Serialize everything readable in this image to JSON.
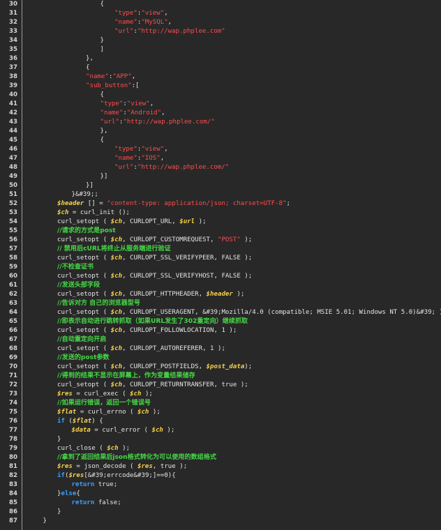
{
  "editor": {
    "lines": [
      {
        "num": "30",
        "indent": 5,
        "tokens": [
          [
            "p",
            "{"
          ]
        ]
      },
      {
        "num": "31",
        "indent": 6,
        "tokens": [
          [
            "s",
            "\"type\""
          ],
          [
            "p",
            ":"
          ],
          [
            "s",
            "\"view\""
          ],
          [
            "p",
            ","
          ]
        ]
      },
      {
        "num": "32",
        "indent": 6,
        "tokens": [
          [
            "s",
            "\"name\""
          ],
          [
            "p",
            ":"
          ],
          [
            "s",
            "\"MySQL\""
          ],
          [
            "p",
            ","
          ]
        ]
      },
      {
        "num": "33",
        "indent": 6,
        "tokens": [
          [
            "s",
            "\"url\""
          ],
          [
            "p",
            ":"
          ],
          [
            "s",
            "\"http://wap.phplee.com\""
          ]
        ]
      },
      {
        "num": "34",
        "indent": 5,
        "tokens": [
          [
            "p",
            "}"
          ]
        ]
      },
      {
        "num": "35",
        "indent": 5,
        "tokens": [
          [
            "p",
            "]"
          ]
        ]
      },
      {
        "num": "36",
        "indent": 4,
        "tokens": [
          [
            "p",
            "},"
          ]
        ]
      },
      {
        "num": "37",
        "indent": 4,
        "tokens": [
          [
            "p",
            "{"
          ]
        ]
      },
      {
        "num": "38",
        "indent": 4,
        "tokens": [
          [
            "s",
            "\"name\""
          ],
          [
            "p",
            ":"
          ],
          [
            "s",
            "\"APP\""
          ],
          [
            "p",
            ","
          ]
        ]
      },
      {
        "num": "39",
        "indent": 4,
        "tokens": [
          [
            "s",
            "\"sub_button\""
          ],
          [
            "p",
            ":["
          ]
        ]
      },
      {
        "num": "40",
        "indent": 5,
        "tokens": [
          [
            "p",
            "{"
          ]
        ]
      },
      {
        "num": "41",
        "indent": 5,
        "tokens": [
          [
            "s",
            "\"type\""
          ],
          [
            "p",
            ":"
          ],
          [
            "s",
            "\"view\""
          ],
          [
            "p",
            ","
          ]
        ]
      },
      {
        "num": "42",
        "indent": 5,
        "tokens": [
          [
            "s",
            "\"name\""
          ],
          [
            "p",
            ":"
          ],
          [
            "s",
            "\"Android\""
          ],
          [
            "p",
            ","
          ]
        ]
      },
      {
        "num": "43",
        "indent": 5,
        "tokens": [
          [
            "s",
            "\"url\""
          ],
          [
            "p",
            ":"
          ],
          [
            "s",
            "\"http://wap.phplee.com/\""
          ]
        ]
      },
      {
        "num": "44",
        "indent": 5,
        "tokens": [
          [
            "p",
            "},"
          ]
        ]
      },
      {
        "num": "45",
        "indent": 5,
        "tokens": [
          [
            "p",
            "{"
          ]
        ]
      },
      {
        "num": "46",
        "indent": 6,
        "tokens": [
          [
            "s",
            "\"type\""
          ],
          [
            "p",
            ":"
          ],
          [
            "s",
            "\"view\""
          ],
          [
            "p",
            ","
          ]
        ]
      },
      {
        "num": "47",
        "indent": 6,
        "tokens": [
          [
            "s",
            "\"name\""
          ],
          [
            "p",
            ":"
          ],
          [
            "s",
            "\"IOS\""
          ],
          [
            "p",
            ","
          ]
        ]
      },
      {
        "num": "48",
        "indent": 6,
        "tokens": [
          [
            "s",
            "\"url\""
          ],
          [
            "p",
            ":"
          ],
          [
            "s",
            "\"http://wap.phplee.com/\""
          ]
        ]
      },
      {
        "num": "49",
        "indent": 5,
        "tokens": [
          [
            "p",
            "}]"
          ]
        ]
      },
      {
        "num": "50",
        "indent": 4,
        "tokens": [
          [
            "p",
            "}]"
          ]
        ]
      },
      {
        "num": "51",
        "indent": 3,
        "tokens": [
          [
            "p",
            "}&#39;;"
          ]
        ]
      },
      {
        "num": "52",
        "indent": 2,
        "tokens": [
          [
            "v",
            "$header"
          ],
          [
            "p",
            " [] = "
          ],
          [
            "s",
            "\"content-type: application/json; charset=UTF-8\""
          ],
          [
            "p",
            ";"
          ]
        ]
      },
      {
        "num": "53",
        "indent": 2,
        "tokens": [
          [
            "v",
            "$ch"
          ],
          [
            "p",
            " = curl_init ();"
          ]
        ]
      },
      {
        "num": "54",
        "indent": 2,
        "tokens": [
          [
            "p",
            "curl_setopt ( "
          ],
          [
            "v",
            "$ch"
          ],
          [
            "p",
            ", CURLOPT_URL, "
          ],
          [
            "v",
            "$url"
          ],
          [
            "p",
            " );"
          ]
        ]
      },
      {
        "num": "55",
        "indent": 2,
        "tokens": [
          [
            "c",
            "//请求的方式是post"
          ]
        ]
      },
      {
        "num": "56",
        "indent": 2,
        "tokens": [
          [
            "p",
            "curl_setopt ( "
          ],
          [
            "v",
            "$ch"
          ],
          [
            "p",
            ", CURLOPT_CUSTOMREQUEST, "
          ],
          [
            "s",
            "\"POST\""
          ],
          [
            "p",
            " );"
          ]
        ]
      },
      {
        "num": "57",
        "indent": 2,
        "tokens": [
          [
            "c",
            "// 禁用后cURL将终止从服务端进行验证"
          ]
        ]
      },
      {
        "num": "58",
        "indent": 2,
        "tokens": [
          [
            "p",
            "curl_setopt ( "
          ],
          [
            "v",
            "$ch"
          ],
          [
            "p",
            ", CURLOPT_SSL_VERIFYPEER, FALSE );"
          ]
        ]
      },
      {
        "num": "59",
        "indent": 2,
        "tokens": [
          [
            "c",
            "//不检查证书"
          ]
        ]
      },
      {
        "num": "60",
        "indent": 2,
        "tokens": [
          [
            "p",
            "curl_setopt ( "
          ],
          [
            "v",
            "$ch"
          ],
          [
            "p",
            ", CURLOPT_SSL_VERIFYHOST, FALSE );"
          ]
        ]
      },
      {
        "num": "61",
        "indent": 2,
        "tokens": [
          [
            "c",
            "//发送头部字段"
          ]
        ]
      },
      {
        "num": "62",
        "indent": 2,
        "tokens": [
          [
            "p",
            "curl_setopt ( "
          ],
          [
            "v",
            "$ch"
          ],
          [
            "p",
            ", CURLOPT_HTTPHEADER, "
          ],
          [
            "v",
            "$header"
          ],
          [
            "p",
            " );"
          ]
        ]
      },
      {
        "num": "63",
        "indent": 2,
        "tokens": [
          [
            "c",
            "//告诉对方 自己的浏览器型号"
          ]
        ]
      },
      {
        "num": "64",
        "indent": 2,
        "tokens": [
          [
            "p",
            "curl_setopt ( "
          ],
          [
            "v",
            "$ch"
          ],
          [
            "p",
            ", CURLOPT_USERAGENT, &#39;Mozilla/4.0 (compatible; MSIE 5.01; Windows NT 5.0)&#39; );"
          ]
        ]
      },
      {
        "num": "65",
        "indent": 2,
        "tokens": [
          [
            "c",
            "//即表示自动进行跳转抓取（如果URL发生了302重定向）继续抓取"
          ]
        ]
      },
      {
        "num": "66",
        "indent": 2,
        "tokens": [
          [
            "p",
            "curl_setopt ( "
          ],
          [
            "v",
            "$ch"
          ],
          [
            "p",
            ", CURLOPT_FOLLOWLOCATION, 1 );"
          ]
        ]
      },
      {
        "num": "67",
        "indent": 2,
        "tokens": [
          [
            "c",
            "//自动重定向开启"
          ]
        ]
      },
      {
        "num": "68",
        "indent": 2,
        "tokens": [
          [
            "p",
            "curl_setopt ( "
          ],
          [
            "v",
            "$ch"
          ],
          [
            "p",
            ", CURLOPT_AUTOREFERER, 1 );"
          ]
        ]
      },
      {
        "num": "69",
        "indent": 2,
        "tokens": [
          [
            "c",
            "//发送的post参数"
          ]
        ]
      },
      {
        "num": "70",
        "indent": 2,
        "tokens": [
          [
            "p",
            "curl_setopt ( "
          ],
          [
            "v",
            "$ch"
          ],
          [
            "p",
            ", CURLOPT_POSTFIELDS, "
          ],
          [
            "v",
            "$post_data"
          ],
          [
            "p",
            ");"
          ]
        ]
      },
      {
        "num": "71",
        "indent": 2,
        "tokens": [
          [
            "c",
            "//得到的结果不显示在屏幕上，作为变量结果储存"
          ]
        ]
      },
      {
        "num": "72",
        "indent": 2,
        "tokens": [
          [
            "p",
            "curl_setopt ( "
          ],
          [
            "v",
            "$ch"
          ],
          [
            "p",
            ", CURLOPT_RETURNTRANSFER, true );"
          ]
        ]
      },
      {
        "num": "73",
        "indent": 2,
        "tokens": [
          [
            "v",
            "$res"
          ],
          [
            "p",
            " = curl_exec ( "
          ],
          [
            "v",
            "$ch"
          ],
          [
            "p",
            " );"
          ]
        ]
      },
      {
        "num": "74",
        "indent": 2,
        "tokens": [
          [
            "c",
            "//如果运行错误，返回一个错误号"
          ]
        ]
      },
      {
        "num": "75",
        "indent": 2,
        "tokens": [
          [
            "v",
            "$flat"
          ],
          [
            "p",
            " = curl_errno ( "
          ],
          [
            "v",
            "$ch"
          ],
          [
            "p",
            " );"
          ]
        ]
      },
      {
        "num": "76",
        "indent": 2,
        "tokens": [
          [
            "k",
            "if"
          ],
          [
            "p",
            " ("
          ],
          [
            "v",
            "$flat"
          ],
          [
            "p",
            ") {"
          ]
        ]
      },
      {
        "num": "77",
        "indent": 3,
        "tokens": [
          [
            "v",
            "$data"
          ],
          [
            "p",
            " = curl_error ( "
          ],
          [
            "v",
            "$ch"
          ],
          [
            "p",
            " );"
          ]
        ]
      },
      {
        "num": "78",
        "indent": 2,
        "tokens": [
          [
            "p",
            "}"
          ]
        ]
      },
      {
        "num": "79",
        "indent": 2,
        "tokens": [
          [
            "p",
            "curl_close ( "
          ],
          [
            "v",
            "$ch"
          ],
          [
            "p",
            " );"
          ]
        ]
      },
      {
        "num": "80",
        "indent": 2,
        "tokens": [
          [
            "c",
            "//拿到了返回结果后json格式转化为可以使用的数组格式"
          ]
        ]
      },
      {
        "num": "81",
        "indent": 2,
        "tokens": [
          [
            "v",
            "$res"
          ],
          [
            "p",
            " = json_decode ( "
          ],
          [
            "v",
            "$res"
          ],
          [
            "p",
            ", true );"
          ]
        ]
      },
      {
        "num": "82",
        "indent": 2,
        "tokens": [
          [
            "k",
            "if"
          ],
          [
            "p",
            "("
          ],
          [
            "v",
            "$res"
          ],
          [
            "p",
            "[&#39;errcode&#39;]==0){"
          ]
        ]
      },
      {
        "num": "83",
        "indent": 3,
        "tokens": [
          [
            "k",
            "return"
          ],
          [
            "p",
            " true;"
          ]
        ]
      },
      {
        "num": "84",
        "indent": 2,
        "tokens": [
          [
            "p",
            "}"
          ],
          [
            "k",
            "else"
          ],
          [
            "p",
            "{"
          ]
        ]
      },
      {
        "num": "85",
        "indent": 3,
        "tokens": [
          [
            "k",
            "return"
          ],
          [
            "p",
            " false;"
          ]
        ]
      },
      {
        "num": "86",
        "indent": 2,
        "tokens": [
          [
            "p",
            "}"
          ]
        ]
      },
      {
        "num": "87",
        "indent": 1,
        "tokens": [
          [
            "p",
            "}"
          ]
        ]
      }
    ]
  }
}
